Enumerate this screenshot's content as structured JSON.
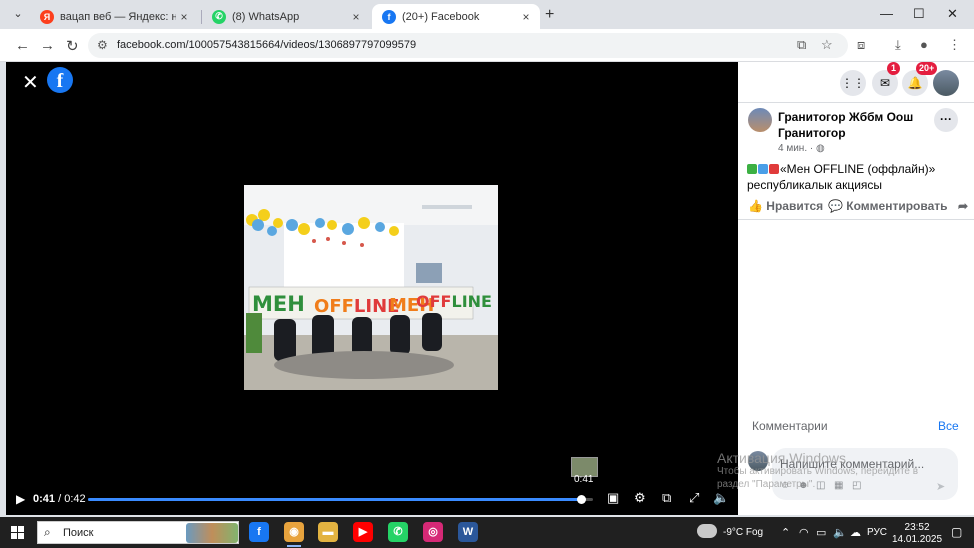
{
  "browser": {
    "tabs": [
      {
        "icon_label": "Я",
        "icon_color": "#fc3f1d",
        "title": "вацап веб — Яндекс: нашлось",
        "close": "×",
        "active": false
      },
      {
        "icon_label": "✆",
        "icon_color": "#25d366",
        "title": "(8) WhatsApp",
        "close": "×",
        "active": false
      },
      {
        "icon_label": "f",
        "icon_color": "#1877f2",
        "title": "(20+) Facebook",
        "close": "×",
        "active": true
      }
    ],
    "new_tab": "+",
    "window_controls": {
      "minimize": "—",
      "maximize": "☐",
      "close": "✕"
    },
    "url": "facebook.com/100057543815664/videos/1306897797099579"
  },
  "video": {
    "current_time": "0:41",
    "duration": "/ 0:42",
    "progress_fraction": 0.976,
    "thumb_time": "0:41",
    "frame_sign_letters": [
      "М",
      "Е",
      "Н",
      " ",
      "O",
      "F",
      "F",
      "L",
      "I",
      "N",
      "E",
      "М",
      "Е",
      "Н",
      "O",
      "F",
      "F",
      "L",
      "I",
      "N",
      "E"
    ]
  },
  "post": {
    "author": "Гранитогор Жббм Оош Гранитогор",
    "time": "4 мин. ·",
    "text_quote": "«Мен OFFLINE (оффлайн)»",
    "text_line2": "республикалык акциясы",
    "like": "Нравится",
    "comment": "Комментировать"
  },
  "header": {
    "messenger_badge": "1",
    "notifications_badge": "20+"
  },
  "comments": {
    "label": "Комментарии",
    "all_link": "Все",
    "placeholder": "Напишите комментарий..."
  },
  "watermark": {
    "line1": "Активация Windows",
    "line2": "Чтобы активировать Windows, перейдите в",
    "line3": "раздел \"Параметры\"."
  },
  "taskbar": {
    "search_label": "Поиск",
    "apps": [
      {
        "name": "facebook-app-icon",
        "glyph": "f",
        "color": "#1877f2",
        "active": false
      },
      {
        "name": "chrome-app-icon",
        "glyph": "◉",
        "color": "#e8a33d",
        "active": true
      },
      {
        "name": "file-explorer-app-icon",
        "glyph": "▬",
        "color": "#e3b341",
        "active": false
      },
      {
        "name": "youtube-app-icon",
        "glyph": "▶",
        "color": "#ff0000",
        "active": false
      },
      {
        "name": "whatsapp-app-icon",
        "glyph": "✆",
        "color": "#25d366",
        "active": false
      },
      {
        "name": "instagram-app-icon",
        "glyph": "◎",
        "color": "#d62976",
        "active": false
      },
      {
        "name": "word-app-icon",
        "glyph": "W",
        "color": "#2b579a",
        "active": false
      }
    ],
    "weather": "-9°C Fog",
    "language": "РУС",
    "time": "23:52",
    "date": "14.01.2025"
  }
}
